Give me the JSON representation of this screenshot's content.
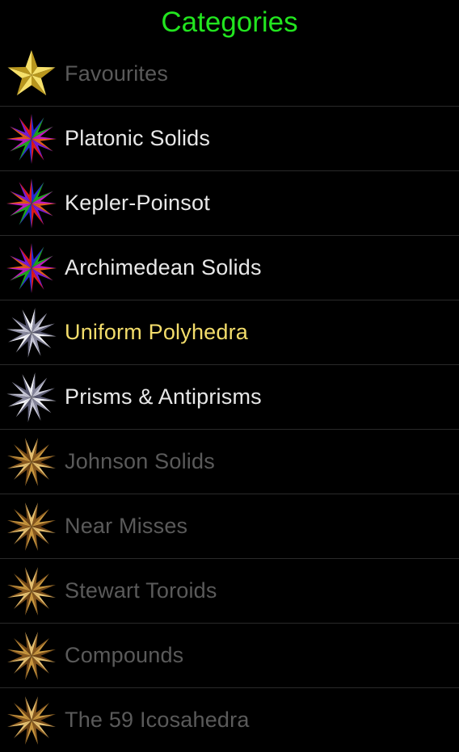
{
  "header": {
    "title": "Categories",
    "title_color": "#22e51f"
  },
  "colors": {
    "enabled_text": "#e8e8e8",
    "selected_text": "#f3dd6b",
    "disabled_text": "#5a5a5a"
  },
  "categories": [
    {
      "label": "Favourites",
      "icon": "gold-star-icon",
      "state": "disabled"
    },
    {
      "label": "Platonic Solids",
      "icon": "multicolor-polyhedron-icon",
      "state": "enabled"
    },
    {
      "label": "Kepler-Poinsot",
      "icon": "multicolor-polyhedron-icon",
      "state": "enabled"
    },
    {
      "label": "Archimedean Solids",
      "icon": "multicolor-polyhedron-icon",
      "state": "enabled"
    },
    {
      "label": "Uniform Polyhedra",
      "icon": "silver-polyhedron-icon",
      "state": "selected"
    },
    {
      "label": "Prisms & Antiprisms",
      "icon": "silver-polyhedron-icon",
      "state": "enabled"
    },
    {
      "label": "Johnson Solids",
      "icon": "bronze-polyhedron-icon",
      "state": "disabled"
    },
    {
      "label": "Near Misses",
      "icon": "bronze-polyhedron-icon",
      "state": "disabled"
    },
    {
      "label": "Stewart Toroids",
      "icon": "bronze-polyhedron-icon",
      "state": "disabled"
    },
    {
      "label": "Compounds",
      "icon": "bronze-polyhedron-icon",
      "state": "disabled"
    },
    {
      "label": "The 59 Icosahedra",
      "icon": "bronze-polyhedron-icon",
      "state": "disabled"
    }
  ]
}
